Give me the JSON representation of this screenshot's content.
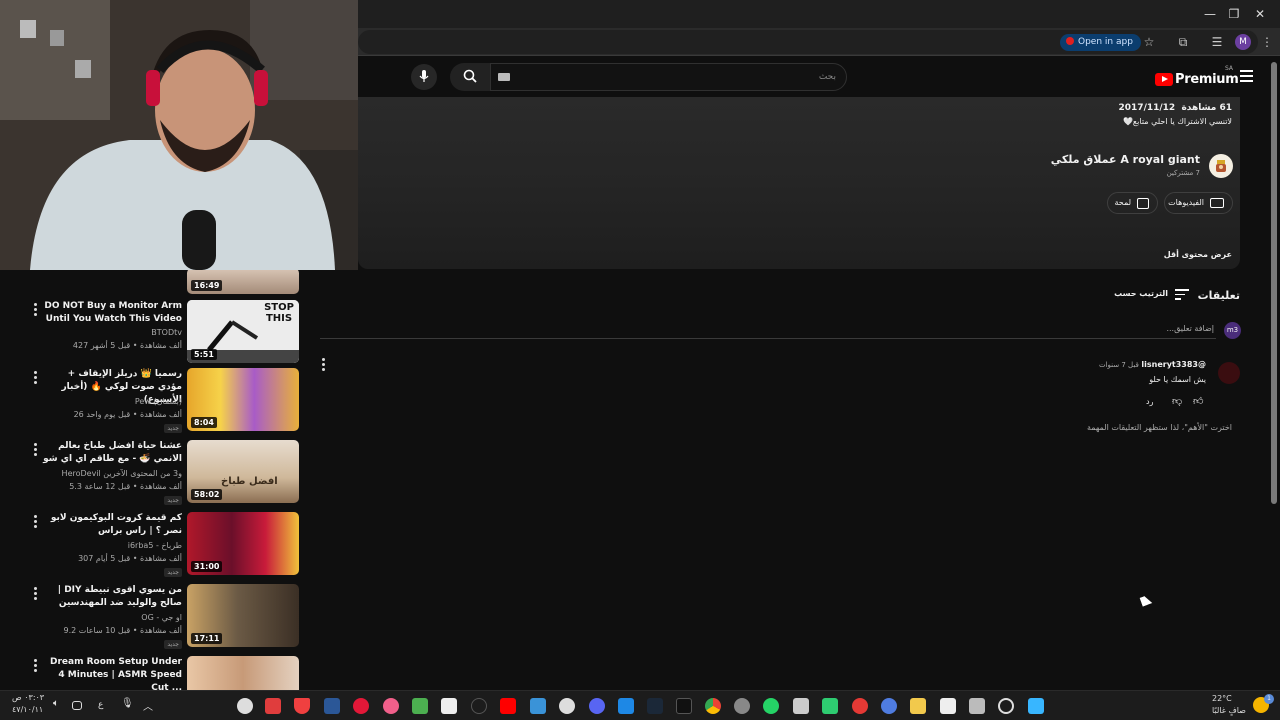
{
  "browser": {
    "open_in_app": "Open in app",
    "profile_initial": "M"
  },
  "header": {
    "logo_text": "Premium",
    "region": "SA",
    "search_placeholder": "بحث"
  },
  "description": {
    "views": "61 مشاهدة",
    "date": "2017/11/12",
    "text": "لاتنسي الاشتراك يا احلي متابع🤍",
    "channel_name": "A royal giant عملاق ملكي",
    "subscribers": "7 مشتركين",
    "videos_button": "الفيديوهات",
    "about_button": "لمحة",
    "show_less": "عرض محتوى أقل"
  },
  "comments": {
    "heading": "تعليقات",
    "sort_label": "الترتيب حسب",
    "add_placeholder": "إضافة تعليق...",
    "user_avatar": "m3",
    "items": [
      {
        "author": "@lisneryt3383",
        "time": "قبل 7 سنوات",
        "text": "يش اسمك يا حلو",
        "reply_label": "رد"
      }
    ],
    "notice": "اخترت \"الأهم\"، لذا ستظهر التعليقات المهمة"
  },
  "sidebar": {
    "top_partial_duration": "16:49",
    "videos": [
      {
        "title": "DO NOT Buy a Monitor Arm Until You Watch This Video",
        "channel": "BTODtv",
        "meta": "427 ألف مشاهدة • قبل 5 أشهر",
        "duration": "5:51",
        "thumb_text": "STOP THIS",
        "badge": ""
      },
      {
        "title": "رسميا 👑 دريلز الإيقاف + مؤدي صوت لوكي 🔥 (أخبار الأسبوع)",
        "channel": "Pew (بسمان)",
        "meta": "26 ألف مشاهدة • قبل يوم واحد",
        "duration": "8:04",
        "thumb_text": "",
        "badge": "جديد"
      },
      {
        "title": "عشنا حياة افضل طباخ بعالم الانمي 🍜 - مع طاقم اي اي شو",
        "channel": "HeroDevil و3 من المحتوى الآخرين",
        "meta": "5.3 ألف مشاهدة • قبل 12 ساعة",
        "duration": "58:02",
        "thumb_text": "افضل طباخ",
        "badge": "جديد"
      },
      {
        "title": "كم قيمة كروت البوكيمون لابو نصر ؟ | راس براس",
        "channel": "i6rba5 - طرباخ",
        "meta": "307 ألف مشاهدة • قبل 5 أيام",
        "duration": "31:00",
        "thumb_text": "",
        "badge": "جديد"
      },
      {
        "title": "من يسوي اقوى نبيطة DIY | صالح والوليد ضد المهندسين",
        "channel": "OG - او جي",
        "meta": "9.2 ألف مشاهدة • قبل 10 ساعات",
        "duration": "17:11",
        "thumb_text": "",
        "badge": "جديد"
      },
      {
        "title": "Dream Room Setup Under 4 Minutes | ASMR Speed Cut ...",
        "channel": "",
        "meta": "",
        "duration": "",
        "thumb_text": "",
        "badge": ""
      }
    ]
  },
  "taskbar": {
    "time": "٠٣:٠٣ ص",
    "date": "٤٧/١٠/١١",
    "lang": "ع",
    "weather_temp": "22°C",
    "weather_desc": "صافٍ غالبًا",
    "notif_count": "1"
  }
}
